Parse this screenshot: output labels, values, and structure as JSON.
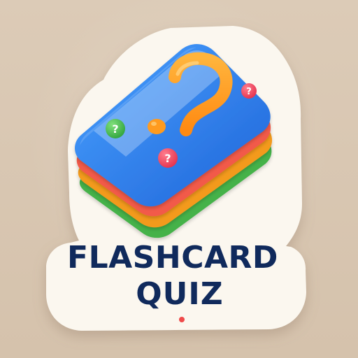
{
  "logo": {
    "title_line1": "FLASHCARD",
    "title_line2": "QUIZ",
    "icons": {
      "main": "question-mark-icon",
      "green": "question-mark-icon",
      "pink_top": "question-mark-icon",
      "pink_middle": "question-mark-icon",
      "decor": "red-dot-icon"
    }
  },
  "colors": {
    "background": "#d9c7b2",
    "sticker": "#fbf7ef",
    "card_blue": "#2f7fe8",
    "card_red": "#f25a4a",
    "card_orange": "#f39a1f",
    "card_green": "#45b24a",
    "accent_orange": "#ff9b1f",
    "text_navy": "#102a5c",
    "badge_pink": "#f24a63",
    "badge_green": "#52c05a"
  }
}
